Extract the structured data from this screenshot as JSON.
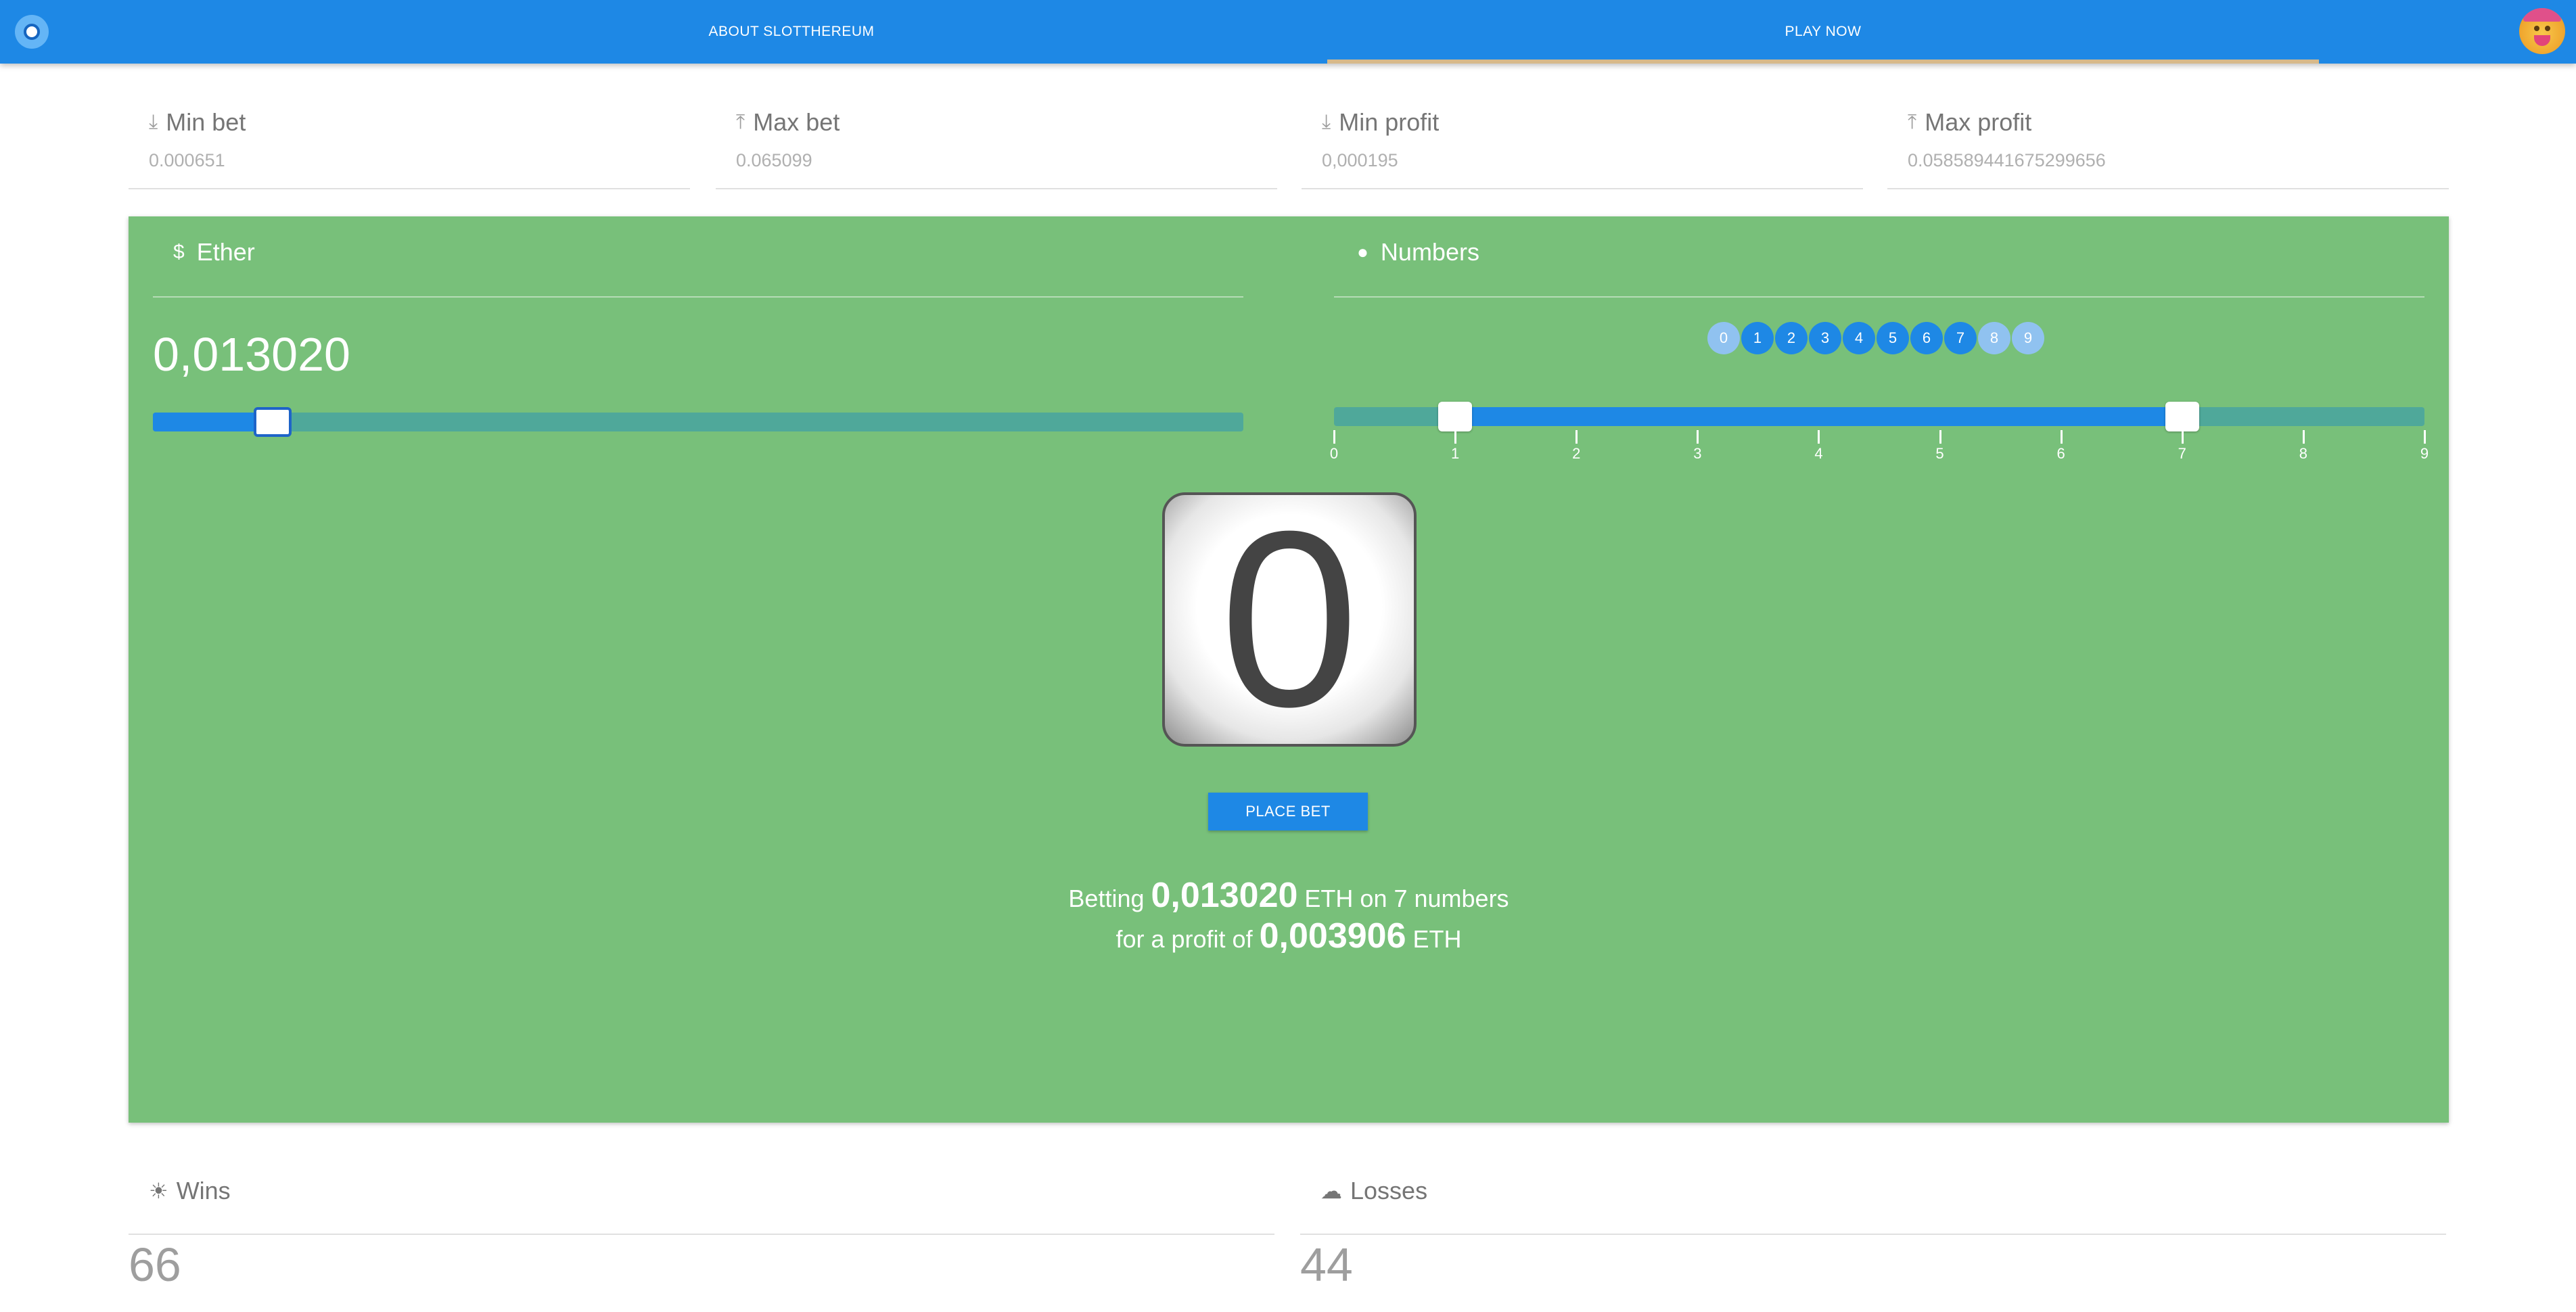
{
  "nav": {
    "about_label": "ABOUT SLOTTHEREUM",
    "play_label": "PLAY NOW"
  },
  "limits": {
    "min_bet": {
      "label": "Min bet",
      "value": "0.000651",
      "icon": "arrow-down-to-line-icon"
    },
    "max_bet": {
      "label": "Max bet",
      "value": "0.065099",
      "icon": "arrow-up-to-line-icon"
    },
    "min_profit": {
      "label": "Min profit",
      "value": "0,000195",
      "icon": "arrow-down-to-line-icon"
    },
    "max_profit": {
      "label": "Max profit",
      "value": "0.058589441675299656",
      "icon": "arrow-up-to-line-icon"
    }
  },
  "ether": {
    "title": "Ether",
    "amount": "0,013020",
    "slider_fraction": 0.11
  },
  "numbers": {
    "title": "Numbers",
    "chips": [
      {
        "label": "0",
        "selected": false
      },
      {
        "label": "1",
        "selected": true
      },
      {
        "label": "2",
        "selected": true
      },
      {
        "label": "3",
        "selected": true
      },
      {
        "label": "4",
        "selected": true
      },
      {
        "label": "5",
        "selected": true
      },
      {
        "label": "6",
        "selected": true
      },
      {
        "label": "7",
        "selected": true
      },
      {
        "label": "8",
        "selected": false
      },
      {
        "label": "9",
        "selected": false
      }
    ],
    "range_min": 1,
    "range_max": 7,
    "ticks": [
      "0",
      "1",
      "2",
      "3",
      "4",
      "5",
      "6",
      "7",
      "8",
      "9"
    ]
  },
  "result": {
    "digit": "0"
  },
  "place_bet_label": "PLACE BET",
  "summary": {
    "line1_prefix": "Betting",
    "bet_amount": "0,013020",
    "line1_suffix": "ETH on 7 numbers",
    "line2_prefix": "for a profit of",
    "profit_amount": "0,003906",
    "line2_suffix": "ETH"
  },
  "stats": {
    "wins": {
      "label": "Wins",
      "value": "66"
    },
    "losses": {
      "label": "Losses",
      "value": "44"
    }
  },
  "colors": {
    "primary": "#1e88e5",
    "panel_green": "#78c07a",
    "track": "#4fa89a"
  }
}
